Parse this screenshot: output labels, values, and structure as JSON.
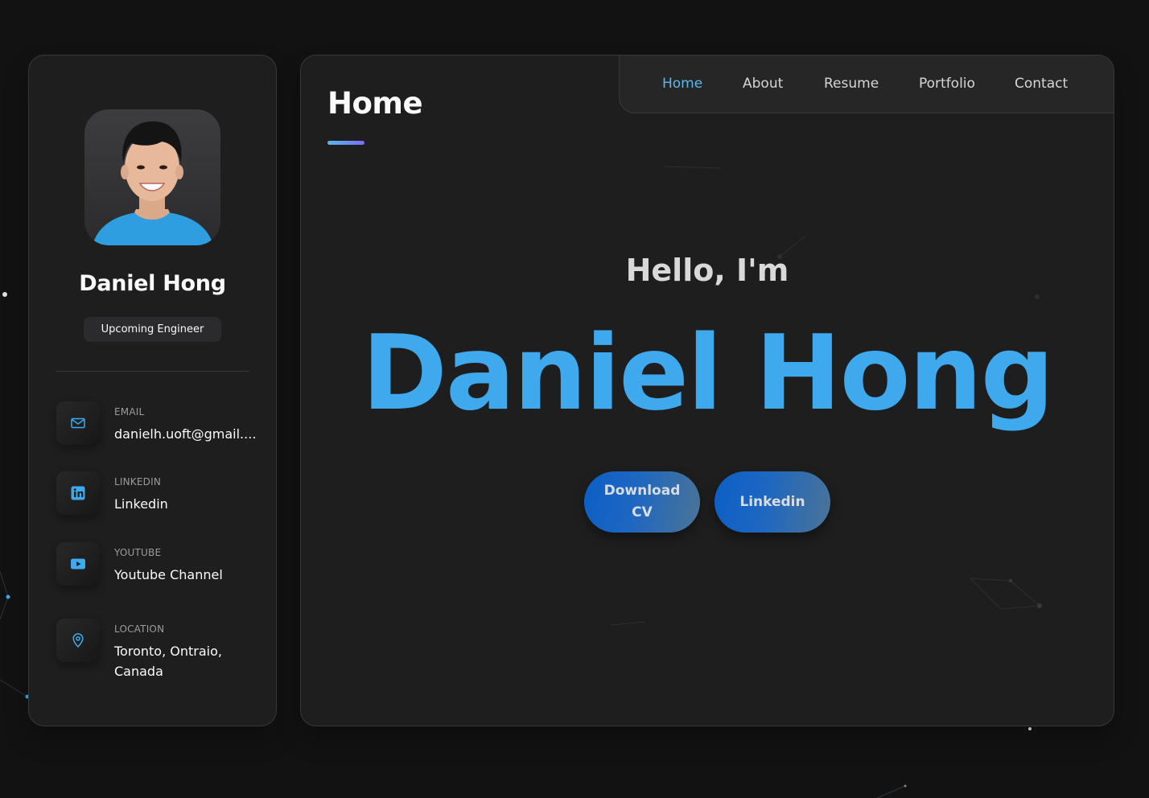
{
  "sidebar": {
    "name": "Daniel Hong",
    "title": "Upcoming Engineer",
    "contacts": [
      {
        "label": "EMAIL",
        "value": "danielh.uoft@gmail....",
        "icon": "mail-icon"
      },
      {
        "label": "LINKEDIN",
        "value": "Linkedin",
        "icon": "linkedin-icon"
      },
      {
        "label": "YOUTUBE",
        "value": "Youtube Channel",
        "icon": "youtube-icon"
      },
      {
        "label": "LOCATION",
        "value": "Toronto, Ontraio, Canada",
        "icon": "location-pin-icon"
      }
    ]
  },
  "nav": {
    "items": [
      "Home",
      "About",
      "Resume",
      "Portfolio",
      "Contact"
    ],
    "active": "Home"
  },
  "main": {
    "page_title": "Home",
    "greeting": "Hello, I'm",
    "hero_name": "Daniel Hong",
    "buttons": {
      "download_cv": "Download CV",
      "linkedin": "Linkedin"
    }
  },
  "colors": {
    "background": "#121212",
    "card": "#1e1e1f",
    "accent": "#3fa9ee",
    "nav_active": "#5ab9ea",
    "button_start": "#0b5fc7",
    "button_end": "#4b7496"
  }
}
